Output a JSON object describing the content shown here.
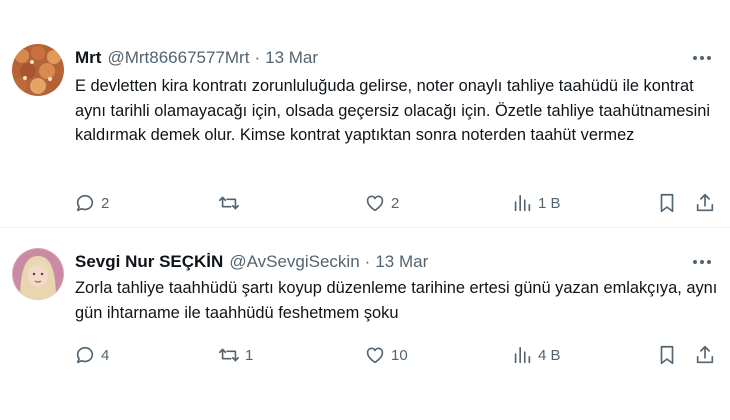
{
  "tweets": [
    {
      "display_name": "Mrt",
      "handle": "@Mrt86667577Mrt",
      "separator": "·",
      "date": "13 Mar",
      "text": "E devletten kira kontratı zorunluluğuda gelirse, noter onaylı tahliye taahüdü ile kontrat aynı tarihli olamayacağı için, olsada geçersiz olacağı için. Özetle tahliye taahütnamesini kaldırmak demek olur. Kimse kontrat yaptıktan sonra noterden taahüt vermez",
      "replies": "2",
      "retweets": "",
      "likes": "2",
      "views": "1 B"
    },
    {
      "display_name": "Sevgi Nur SEÇKİN",
      "handle": "@AvSevgiSeckin",
      "separator": "·",
      "date": "13 Mar",
      "text": "Zorla tahliye taahhüdü şartı koyup düzenleme tarihine ertesi günü yazan emlakçıya, aynı gün ihtarname ile taahhüdü feshetmem şoku",
      "replies": "4",
      "retweets": "1",
      "likes": "10",
      "views": "4 B"
    }
  ],
  "colors": {
    "text_primary": "#0f1419",
    "text_secondary": "#536471",
    "divider": "#eff3f4"
  },
  "icons": [
    "reply-icon",
    "retweet-icon",
    "like-icon",
    "views-icon",
    "bookmark-icon",
    "share-icon",
    "more-icon"
  ]
}
